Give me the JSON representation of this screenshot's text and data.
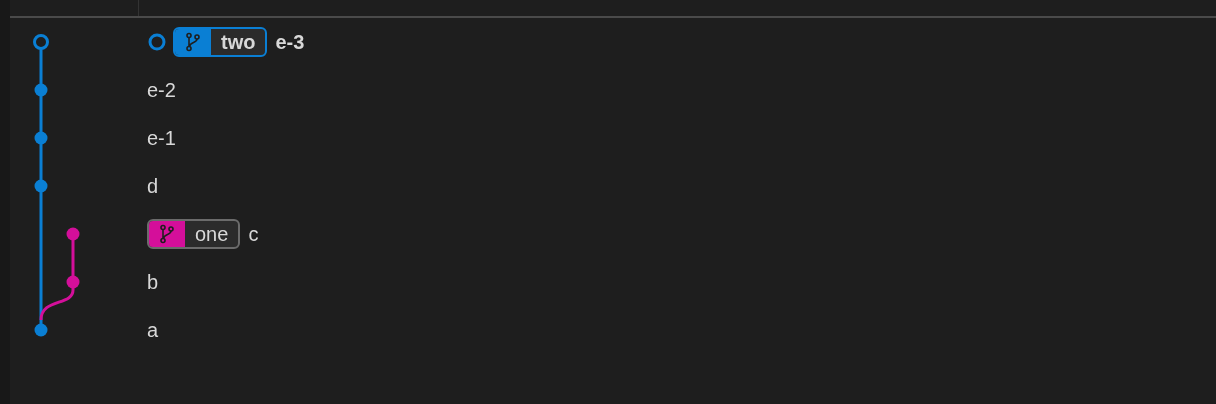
{
  "commits": [
    {
      "message": "e-3",
      "kind": "main",
      "color": "#0a7fd4",
      "head": true,
      "branch": {
        "name": "two",
        "color": "#0a7fd4",
        "current": true
      }
    },
    {
      "message": "e-2",
      "kind": "main",
      "color": "#0a7fd4",
      "head": false
    },
    {
      "message": "e-1",
      "kind": "main",
      "color": "#0a7fd4",
      "head": false
    },
    {
      "message": "d",
      "kind": "main",
      "color": "#0a7fd4",
      "head": false
    },
    {
      "message": "c",
      "kind": "side",
      "color": "#d40f9a",
      "head": false,
      "branch": {
        "name": "one",
        "color": "#d40f9a",
        "current": false
      }
    },
    {
      "message": "b",
      "kind": "side",
      "color": "#d40f9a",
      "head": false
    },
    {
      "message": "a",
      "kind": "main",
      "color": "#0a7fd4",
      "head": false
    }
  ]
}
